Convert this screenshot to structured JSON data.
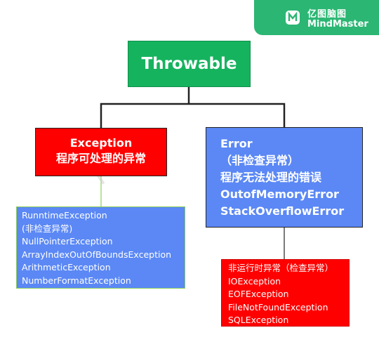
{
  "badge": {
    "cn": "亿图脑图",
    "en": "MindMaster"
  },
  "root": {
    "label": "Throwable"
  },
  "exception": {
    "line1": "Exception",
    "line2": "程序可处理的异常"
  },
  "error": {
    "lines": [
      "Error",
      "（非检查异常）",
      "程序无法处理的错误",
      "OutofMemoryError",
      "StackOverflowError"
    ]
  },
  "exception_children": [
    "RunntimeException",
    "(非检查异常)",
    "NullPointerException",
    "ArrayIndexOutOfBoundsException",
    "ArithmeticException",
    "NumberFormatException"
  ],
  "error_children": [
    "非运行时异常（检查异常）",
    "IOException",
    "EOFException",
    "FileNotFoundException",
    "SQLException"
  ],
  "colors": {
    "green": "#16b35f",
    "red": "#ff0000",
    "blue": "#5b88f5",
    "badge": "#2bb673"
  },
  "icons": {
    "badge_logo": "mindmaster-logo-icon"
  }
}
